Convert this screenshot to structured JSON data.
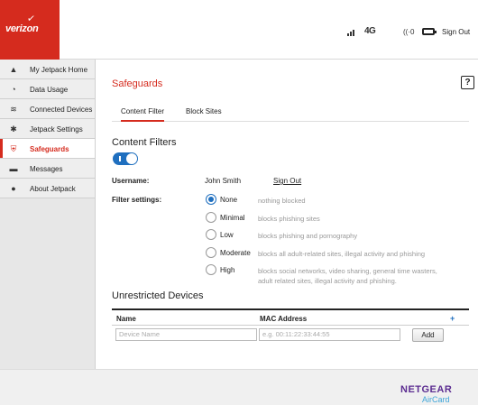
{
  "header": {
    "logo_text": "verizon",
    "network_type": "4G",
    "wifi_count": "0",
    "sign_out": "Sign Out"
  },
  "sidebar": {
    "items": [
      {
        "label": "My Jetpack Home",
        "icon": "home-icon"
      },
      {
        "label": "Data Usage",
        "icon": "gauge-icon"
      },
      {
        "label": "Connected Devices",
        "icon": "wifi-icon"
      },
      {
        "label": "Jetpack Settings",
        "icon": "gear-icon"
      },
      {
        "label": "Safeguards",
        "icon": "shield-icon",
        "active": true
      },
      {
        "label": "Messages",
        "icon": "message-icon"
      },
      {
        "label": "About Jetpack",
        "icon": "info-icon"
      }
    ]
  },
  "main": {
    "title": "Safeguards",
    "help": "?",
    "tabs": [
      {
        "label": "Content Filter",
        "active": true
      },
      {
        "label": "Block Sites"
      }
    ],
    "content_filters": {
      "heading": "Content Filters",
      "toggle_on": true,
      "username_label": "Username:",
      "username": "John Smith",
      "sign_out_link": "Sign Out",
      "filter_label": "Filter settings:",
      "options": [
        {
          "label": "None",
          "desc": "nothing blocked",
          "selected": true
        },
        {
          "label": "Minimal",
          "desc": "blocks phishing sites"
        },
        {
          "label": "Low",
          "desc": "blocks phishing and pornography"
        },
        {
          "label": "Moderate",
          "desc": "blocks all adult-related sites, illegal activity and phishing"
        },
        {
          "label": "High",
          "desc": "blocks social networks, video sharing, general time wasters, adult related sites, illegal activity and phishing."
        }
      ]
    },
    "devices": {
      "heading": "Unrestricted Devices",
      "col_name": "Name",
      "col_mac": "MAC Address",
      "add_plus": "+",
      "name_placeholder": "Device Name",
      "mac_placeholder": "e.g. 00:11:22:33:44:55",
      "add_button": "Add"
    }
  },
  "footer": {
    "brand": "NETGEAR",
    "product": "AirCard"
  },
  "colors": {
    "accent": "#d52b1e",
    "toggle": "#1f6fbf",
    "brand": "#5c2d91",
    "product": "#3fa6d9"
  }
}
